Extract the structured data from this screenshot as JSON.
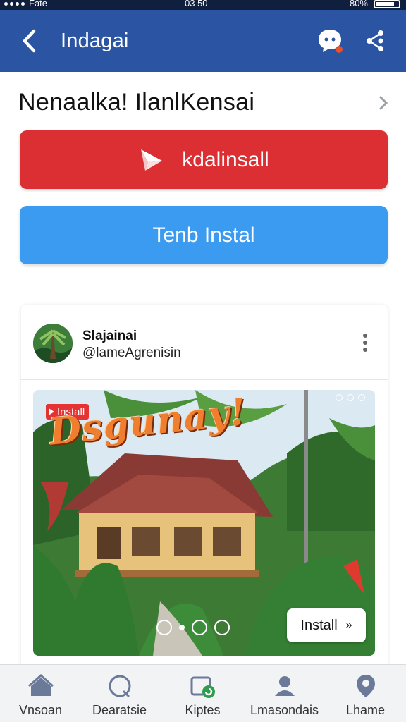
{
  "status_bar": {
    "carrier": "Fate",
    "time": "03 50",
    "battery": "80%"
  },
  "app_bar": {
    "title": "Indagai",
    "icons": [
      "back-arrow-icon",
      "chat-bubble-icon",
      "share-icon"
    ],
    "color": "#2b55a3"
  },
  "main": {
    "heading": "Nenaalka! IlanlKensai",
    "primary_button": {
      "label": "kdalinsall",
      "icon": "send-plane-icon",
      "color": "#dc2f33"
    },
    "secondary_button": {
      "label": "Tenb Instal",
      "color": "#3a9bf0"
    }
  },
  "post": {
    "name": "Slajainai",
    "handle": "@lameAgrenisin",
    "media": {
      "badge": "Install",
      "overlay_title": "Dsgunay!",
      "cta": "Install",
      "cta_icon": "double-chevron-right-icon"
    }
  },
  "bottom_nav": [
    {
      "label": "Vnsoan",
      "icon": "home-icon"
    },
    {
      "label": "Dearatsie",
      "icon": "search-icon"
    },
    {
      "label": "Kiptes",
      "icon": "folder-app-icon"
    },
    {
      "label": "Lmasondais",
      "icon": "profile-icon"
    },
    {
      "label": "Lhame",
      "icon": "location-icon"
    }
  ]
}
